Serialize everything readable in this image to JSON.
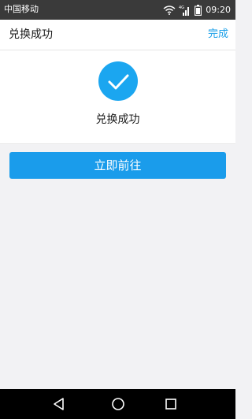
{
  "status_bar": {
    "carrier": "中国移动",
    "network_label": "4G",
    "time": "09:20",
    "icons": [
      "wifi-icon",
      "cellular-signal-icon",
      "battery-icon"
    ]
  },
  "header": {
    "title": "兑换成功",
    "done_label": "完成"
  },
  "success": {
    "icon": "checkmark-icon",
    "message": "兑换成功"
  },
  "actions": {
    "go_now_label": "立即前往"
  },
  "system_nav": {
    "icons": [
      "back-triangle-icon",
      "home-circle-icon",
      "recent-apps-square-icon"
    ]
  },
  "colors": {
    "accent": "#1a9ceb",
    "status_bar": "#3a3a3a",
    "background": "#f2f2f4"
  }
}
